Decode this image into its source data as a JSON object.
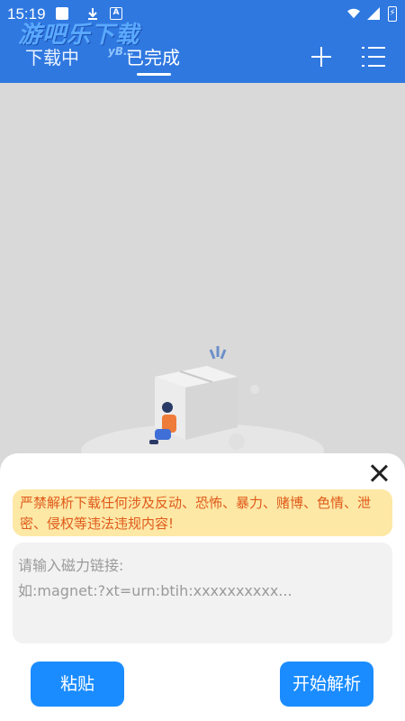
{
  "status_bar": {
    "time": "15:19",
    "battery_glyph": "⚡"
  },
  "watermark": {
    "text": "游吧乐下载",
    "sub": "yB…"
  },
  "tabs": [
    {
      "label": "下载中"
    },
    {
      "label": "已完成"
    }
  ],
  "actions": {
    "add_icon": "plus-icon",
    "menu_icon": "list-icon"
  },
  "dialog": {
    "warning": "严禁解析下载任何涉及反动、恐怖、暴力、赌博、色情、泄密、侵权等违法违规内容!",
    "input_placeholder_line1": "请输入磁力链接:",
    "input_placeholder_line2": "如:magnet:?xt=urn:btih:xxxxxxxxxx...",
    "paste_label": "粘贴",
    "parse_label": "开始解析"
  },
  "colors": {
    "appbar": "#2f78e0",
    "primary_button": "#1a8cff",
    "warning_bg": "#fde8a6",
    "warning_text": "#e05a1a"
  }
}
